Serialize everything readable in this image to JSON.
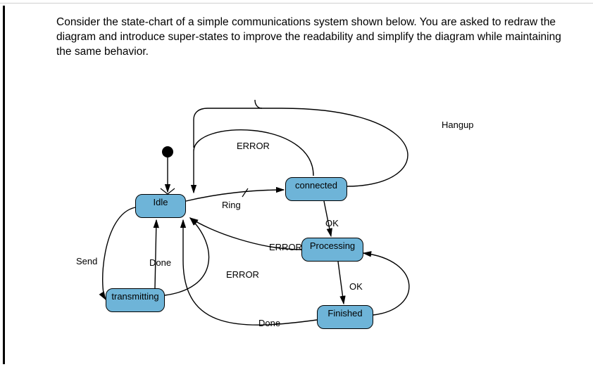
{
  "prompt": "Consider the state-chart of a simple communications system shown below. You are asked to redraw the diagram and introduce super-states to improve the readability and simplify the diagram while maintaining the same behavior.",
  "states": {
    "idle": "Idle",
    "connected": "connected",
    "processing": "Processing",
    "finished": "Finished",
    "transmitting": "transmitting"
  },
  "transitions": {
    "ring": "Ring",
    "hangup": "Hangup",
    "ok1": "OK",
    "ok2": "OK",
    "error_conn_idle": "ERROR",
    "error_proc_idle": "ERROR",
    "error_trans_idle": "ERROR",
    "send": "Send",
    "done_trans_idle": "Done",
    "done_finished_idle": "Done"
  }
}
